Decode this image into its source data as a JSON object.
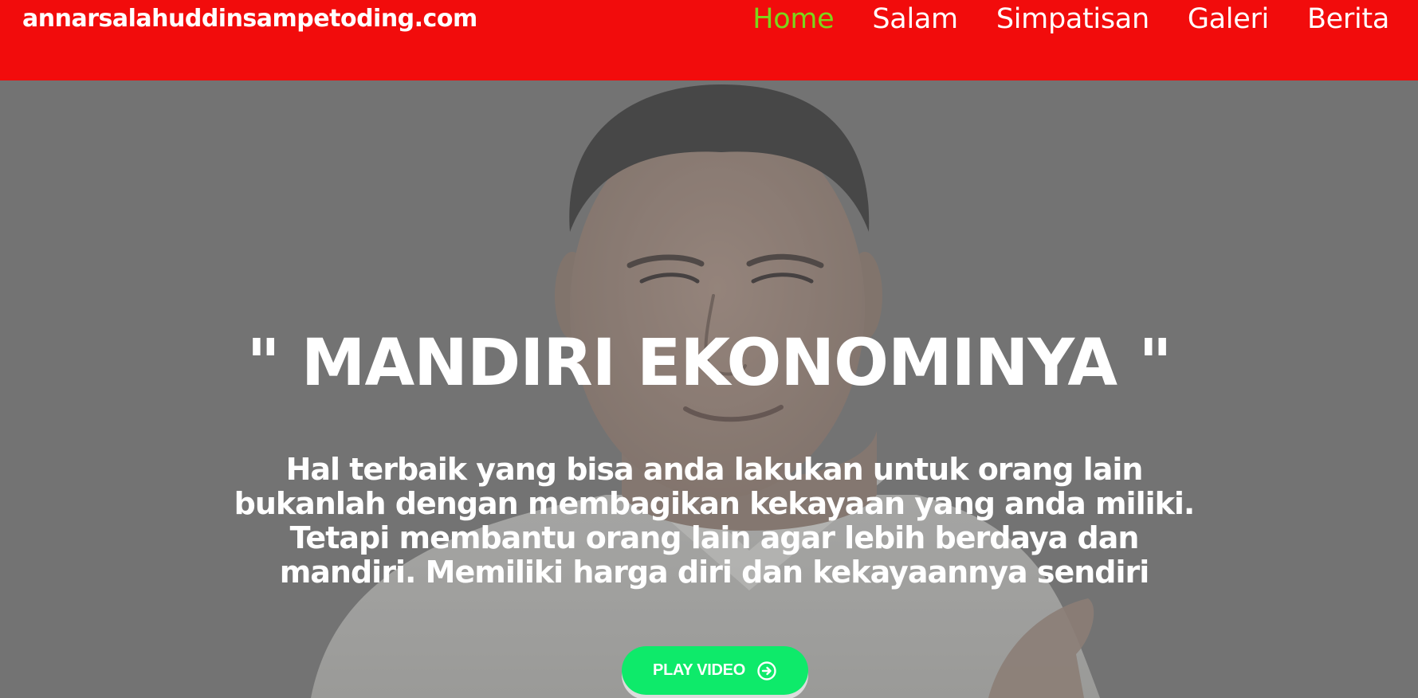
{
  "header": {
    "brand": "annarsalahuddinsampetoding.com",
    "nav": [
      {
        "label": "Home",
        "active": true
      },
      {
        "label": "Salam",
        "active": false
      },
      {
        "label": "Simpatisan",
        "active": false
      },
      {
        "label": "Galeri",
        "active": false
      },
      {
        "label": "Berita",
        "active": false
      }
    ]
  },
  "hero": {
    "headline": "\" MANDIRI EKONOMINYA \"",
    "subtext": "Hal terbaik yang bisa anda lakukan untuk orang lain bukanlah dengan membagikan kekayaan yang anda miliki. Tetapi membantu orang lain agar lebih berdaya dan mandiri. Memiliki harga diri dan kekayaannya sendiri",
    "play_button_label": "PLAY VIDEO",
    "play_button_icon": "arrow-circle-right-icon"
  },
  "colors": {
    "header_bg": "#f20c0c",
    "nav_active": "#7cd61a",
    "nav_text": "#ffffff",
    "hero_overlay": "#737373",
    "button_bg": "#0eea6a"
  }
}
